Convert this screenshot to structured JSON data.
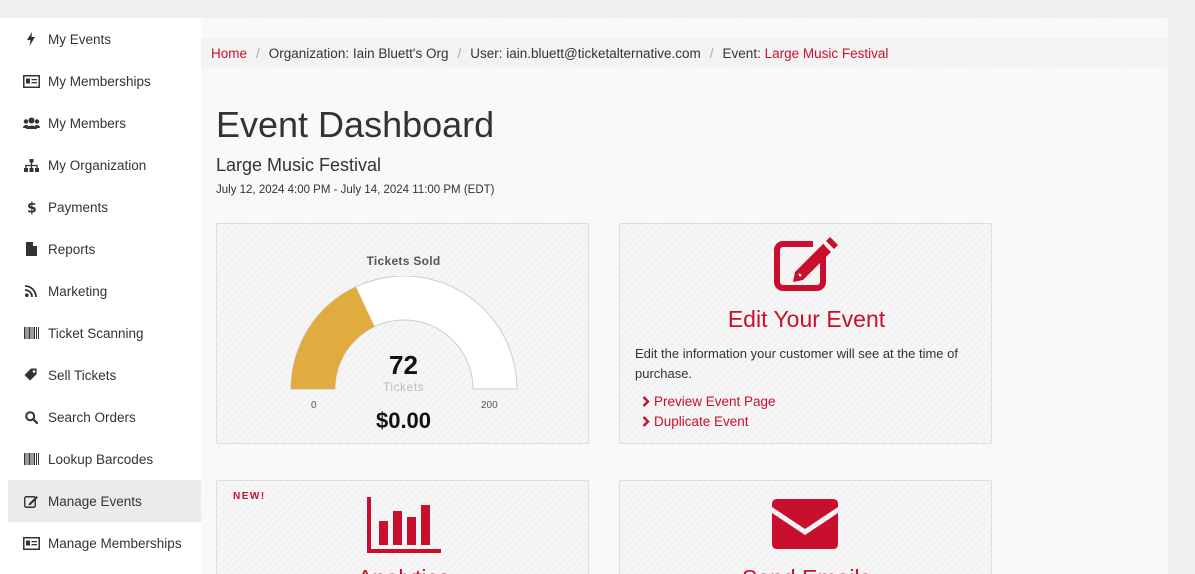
{
  "sidebar": {
    "items": [
      {
        "label": "My Events",
        "icon": "bolt-icon"
      },
      {
        "label": "My Memberships",
        "icon": "id-card-icon"
      },
      {
        "label": "My Members",
        "icon": "users-icon"
      },
      {
        "label": "My Organization",
        "icon": "org-chart-icon"
      },
      {
        "label": "Payments",
        "icon": "dollar-icon"
      },
      {
        "label": "Reports",
        "icon": "file-icon"
      },
      {
        "label": "Marketing",
        "icon": "rss-icon"
      },
      {
        "label": "Ticket Scanning",
        "icon": "barcode-icon"
      },
      {
        "label": "Sell Tickets",
        "icon": "tag-icon"
      },
      {
        "label": "Search Orders",
        "icon": "search-icon"
      },
      {
        "label": "Lookup Barcodes",
        "icon": "barcode-icon"
      },
      {
        "label": "Manage Events",
        "icon": "edit-icon",
        "active": true
      },
      {
        "label": "Manage Memberships",
        "icon": "id-card-icon"
      }
    ]
  },
  "breadcrumb": {
    "home": "Home",
    "organization": "Organization: Iain Bluett's Org",
    "user": "User: iain.bluett@ticketalternative.com",
    "event_prefix": "Event: ",
    "event_link": "Large Music Festival"
  },
  "page": {
    "title": "Event Dashboard",
    "event_name": "Large Music Festival",
    "event_dates": "July 12, 2024 4:00 PM - July 14, 2024 11:00 PM (EDT)"
  },
  "tickets_card": {
    "title": "Tickets Sold",
    "value": "72",
    "unit": "Tickets",
    "min": "0",
    "max": "200",
    "revenue": "$0.00",
    "fill_fraction": 0.36,
    "fill_color": "#e0ac40"
  },
  "edit_card": {
    "title": "Edit Your Event",
    "description": "Edit the information your customer will see at the time of purchase.",
    "links": [
      "Preview Event Page",
      "Duplicate Event"
    ],
    "icon": "edit-icon"
  },
  "analytics_card": {
    "badge": "NEW!",
    "title": "Analytics",
    "icon": "bar-chart-icon"
  },
  "email_card": {
    "title": "Send Emails",
    "icon": "envelope-icon"
  },
  "colors": {
    "accent": "#c8102e",
    "gauge_fill": "#e0ac40"
  }
}
